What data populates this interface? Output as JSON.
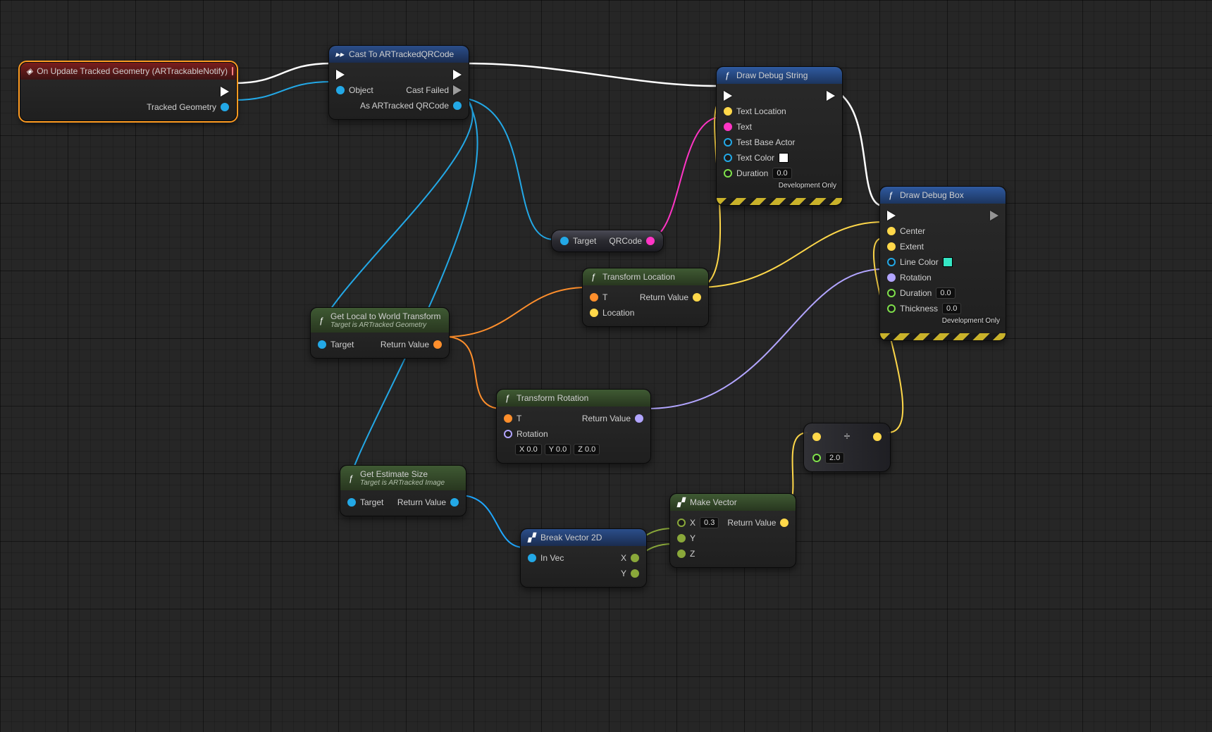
{
  "nodes": {
    "event": {
      "title": "On Update Tracked Geometry (ARTrackableNotify)",
      "out_exec": "",
      "out_data": "Tracked Geometry"
    },
    "cast": {
      "title": "Cast To ARTrackedQRCode",
      "in_object": "Object",
      "out_fail": "Cast Failed",
      "out_as": "As ARTracked QRCode"
    },
    "drawString": {
      "title": "Draw Debug String",
      "p_textloc": "Text Location",
      "p_text": "Text",
      "p_actor": "Test Base Actor",
      "p_color": "Text Color",
      "p_duration": "Duration",
      "v_duration": "0.0",
      "dev": "Development Only"
    },
    "drawBox": {
      "title": "Draw Debug Box",
      "p_center": "Center",
      "p_extent": "Extent",
      "p_linecolor": "Line Color",
      "p_rotation": "Rotation",
      "p_duration": "Duration",
      "v_duration": "0.0",
      "p_thickness": "Thickness",
      "v_thickness": "0.0",
      "dev": "Development Only"
    },
    "qrcode": {
      "in": "Target",
      "out": "QRCode"
    },
    "transformLoc": {
      "title": "Transform Location",
      "in_t": "T",
      "in_loc": "Location",
      "out": "Return Value"
    },
    "l2w": {
      "title": "Get Local to World Transform",
      "sub": "Target is ARTracked Geometry",
      "in": "Target",
      "out": "Return Value"
    },
    "transformRot": {
      "title": "Transform Rotation",
      "in_t": "T",
      "in_rot": "Rotation",
      "v_x": "0.0",
      "v_y": "0.0",
      "v_z": "0.0",
      "out": "Return Value"
    },
    "estSize": {
      "title": "Get Estimate Size",
      "sub": "Target is ARTracked Image",
      "in": "Target",
      "out": "Return Value"
    },
    "breakV2": {
      "title": "Break Vector 2D",
      "in": "In Vec",
      "out_x": "X",
      "out_y": "Y"
    },
    "makeVec": {
      "title": "Make Vector",
      "in_x": "X",
      "v_x": "0.3",
      "in_y": "Y",
      "in_z": "Z",
      "out": "Return Value"
    },
    "divide": {
      "op": "÷",
      "v": "2.0"
    }
  }
}
